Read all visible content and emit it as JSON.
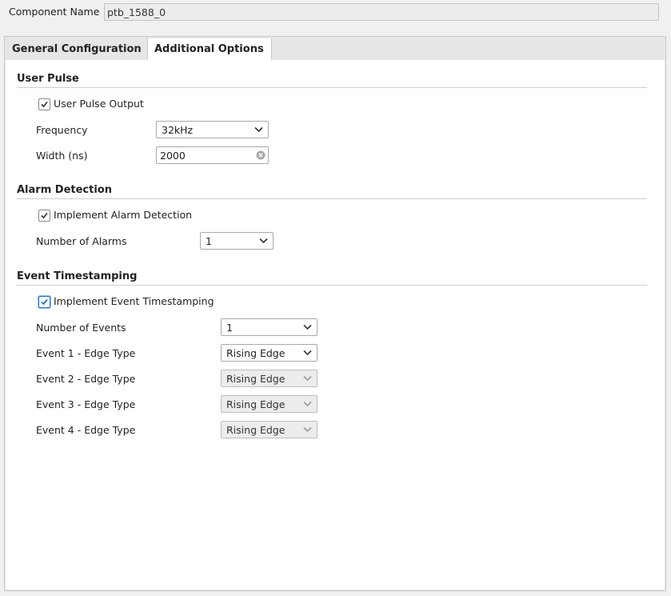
{
  "component_name": {
    "label": "Component Name",
    "value": "ptb_1588_0"
  },
  "tabs": [
    {
      "label": "General Configuration",
      "active": false
    },
    {
      "label": "Additional Options",
      "active": true
    }
  ],
  "user_pulse": {
    "title": "User Pulse",
    "output_checkbox": {
      "label": "User Pulse Output",
      "checked": true
    },
    "frequency": {
      "label": "Frequency",
      "value": "32kHz"
    },
    "width": {
      "label": "Width (ns)",
      "value": "2000"
    }
  },
  "alarm": {
    "title": "Alarm Detection",
    "implement_checkbox": {
      "label": "Implement Alarm Detection",
      "checked": true
    },
    "num_alarms": {
      "label": "Number of Alarms",
      "value": "1"
    }
  },
  "event": {
    "title": "Event Timestamping",
    "implement_checkbox": {
      "label": "Implement Event Timestamping",
      "checked": true
    },
    "num_events": {
      "label": "Number of Events",
      "value": "1"
    },
    "edges": [
      {
        "label": "Event 1 - Edge Type",
        "value": "Rising Edge",
        "enabled": true
      },
      {
        "label": "Event 2 - Edge Type",
        "value": "Rising Edge",
        "enabled": false
      },
      {
        "label": "Event 3 - Edge Type",
        "value": "Rising Edge",
        "enabled": false
      },
      {
        "label": "Event 4 - Edge Type",
        "value": "Rising Edge",
        "enabled": false
      }
    ]
  },
  "colors": {
    "focus": "#2f6fb5",
    "panel": "#e6e6e6",
    "content": "#ffffff"
  }
}
